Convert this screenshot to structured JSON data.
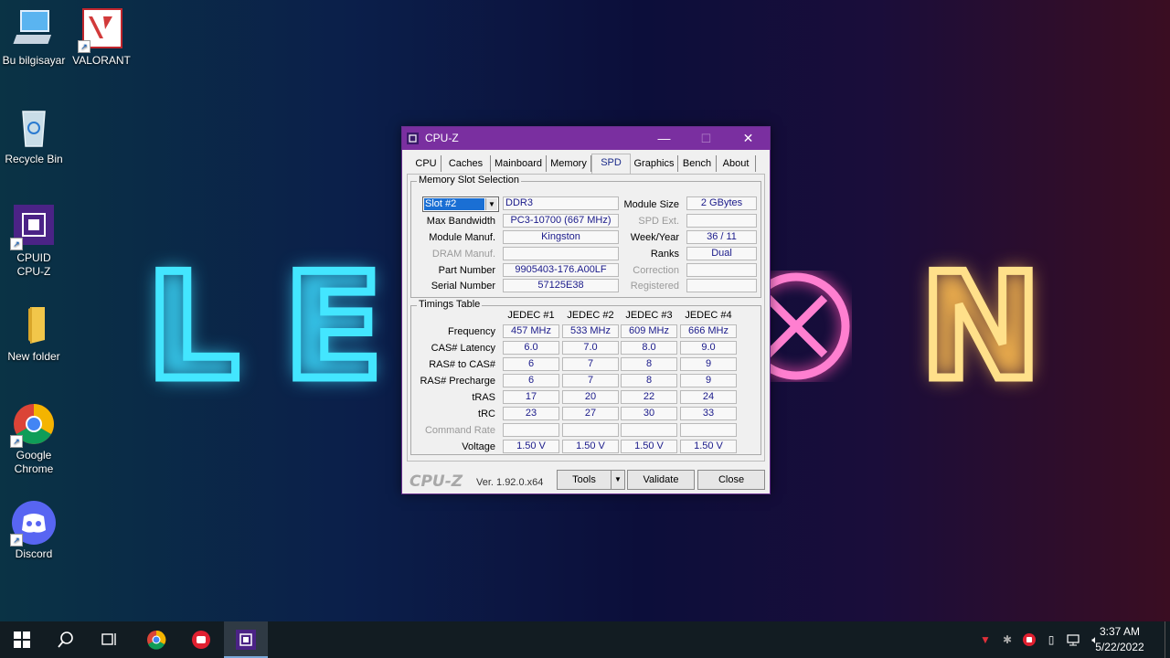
{
  "desktop": {
    "icons": [
      {
        "label": "Bu bilgisayar"
      },
      {
        "label": "VALORANT"
      },
      {
        "label": "Recycle Bin"
      },
      {
        "label": "CPUID CPU-Z"
      },
      {
        "label": "New folder"
      },
      {
        "label": "Google Chrome"
      },
      {
        "label": "Discord"
      }
    ],
    "wallpaper_letters": {
      "l": "L",
      "e": "E",
      "n": "N"
    }
  },
  "window": {
    "title": "CPU-Z",
    "accent": "#7a2fa0",
    "controls": {
      "minimize": "—",
      "maximize": "☐",
      "close": "✕"
    },
    "tabs": [
      "CPU",
      "Caches",
      "Mainboard",
      "Memory",
      "SPD",
      "Graphics",
      "Bench",
      "About"
    ],
    "active_tab": "SPD",
    "slot_group": {
      "label": "Memory Slot Selection",
      "slot_selected": "Slot #2",
      "type": "DDR3",
      "module_size_label": "Module Size",
      "module_size": "2 GBytes",
      "max_bandwidth_label": "Max Bandwidth",
      "max_bandwidth": "PC3-10700 (667 MHz)",
      "spd_ext_label": "SPD Ext.",
      "spd_ext": "",
      "module_manuf_label": "Module Manuf.",
      "module_manuf": "Kingston",
      "week_year_label": "Week/Year",
      "week_year": "36 / 11",
      "dram_manuf_label": "DRAM Manuf.",
      "dram_manuf": "",
      "ranks_label": "Ranks",
      "ranks": "Dual",
      "part_number_label": "Part Number",
      "part_number": "9905403-176.A00LF",
      "correction_label": "Correction",
      "correction": "",
      "serial_number_label": "Serial Number",
      "serial_number": "57125E38",
      "registered_label": "Registered",
      "registered": ""
    },
    "timings": {
      "label": "Timings Table",
      "columns": [
        "JEDEC #1",
        "JEDEC #2",
        "JEDEC #3",
        "JEDEC #4"
      ],
      "rows": [
        {
          "label": "Frequency",
          "values": [
            "457 MHz",
            "533 MHz",
            "609 MHz",
            "666 MHz"
          ]
        },
        {
          "label": "CAS# Latency",
          "values": [
            "6.0",
            "7.0",
            "8.0",
            "9.0"
          ]
        },
        {
          "label": "RAS# to CAS#",
          "values": [
            "6",
            "7",
            "8",
            "9"
          ]
        },
        {
          "label": "RAS# Precharge",
          "values": [
            "6",
            "7",
            "8",
            "9"
          ]
        },
        {
          "label": "tRAS",
          "values": [
            "17",
            "20",
            "22",
            "24"
          ]
        },
        {
          "label": "tRC",
          "values": [
            "23",
            "27",
            "30",
            "33"
          ]
        },
        {
          "label": "Command Rate",
          "values": [
            "",
            "",
            "",
            ""
          ]
        },
        {
          "label": "Voltage",
          "values": [
            "1.50 V",
            "1.50 V",
            "1.50 V",
            "1.50 V"
          ]
        }
      ]
    },
    "footer": {
      "logo": "CPU-Z",
      "version": "Ver. 1.92.0.x64",
      "tools_label": "Tools",
      "validate_label": "Validate",
      "close_label": "Close"
    }
  },
  "taskbar": {
    "clock_time": "3:37 AM",
    "clock_date": "5/22/2022"
  }
}
